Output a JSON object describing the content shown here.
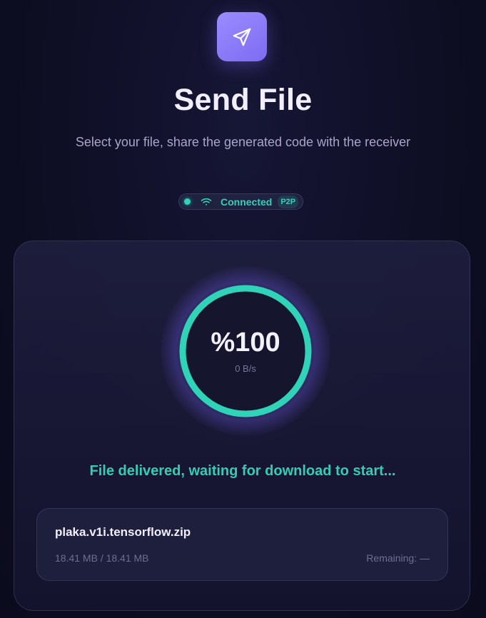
{
  "header": {
    "icon": "paper-plane-icon",
    "title": "Send File",
    "subtitle": "Select your file, share the generated code with the receiver"
  },
  "connection": {
    "status": "Connected",
    "mode": "P2P",
    "icon": "wifi-icon",
    "color": "#2fd3b8"
  },
  "progress": {
    "percent_label": "%100",
    "percent": 100,
    "speed": "0 B/s",
    "ring_color": "#2fd3b8",
    "message": "File delivered, waiting for download to start..."
  },
  "file": {
    "name": "plaka.v1i.tensorflow.zip",
    "size": "18.41 MB / 18.41 MB",
    "remaining": "Remaining: —"
  },
  "colors": {
    "accent": "#8b7bff",
    "success": "#33cdb3",
    "background": "#0e0e24"
  }
}
